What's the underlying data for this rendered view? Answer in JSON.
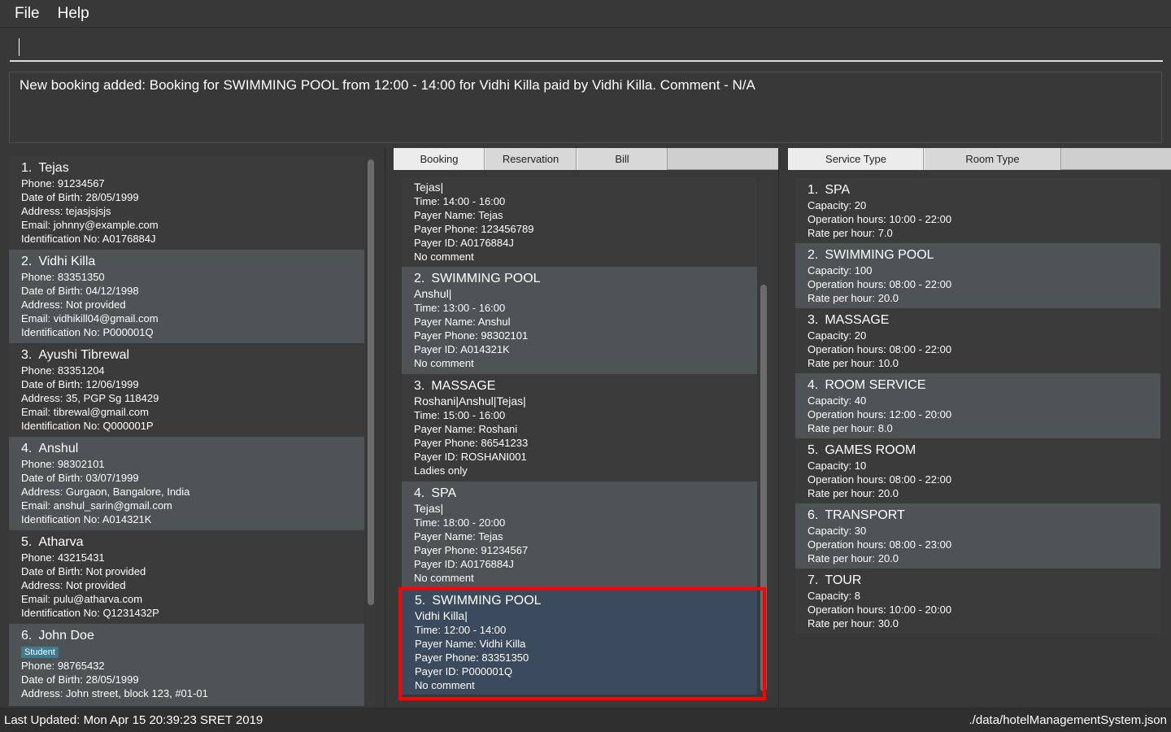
{
  "menu": [
    "File",
    "Help"
  ],
  "command": {
    "value": "",
    "placeholder": ""
  },
  "result": "New booking added: Booking for SWIMMING POOL from 12:00 - 14:00 for Vidhi Killa paid by Vidhi Killa. Comment - N/A",
  "customers": [
    {
      "num": "1.",
      "name": "Tejas",
      "tag": "",
      "lines": [
        "Phone: 91234567",
        "Date of Birth: 28/05/1999",
        "Address: tejasjsjsjs",
        "Email: johnny@example.com",
        "Identification No: A0176884J"
      ]
    },
    {
      "num": "2.",
      "name": "Vidhi Killa",
      "tag": "",
      "lines": [
        "Phone: 83351350",
        "Date of Birth: 04/12/1998",
        "Address: Not provided",
        "Email: vidhikill04@gmail.com",
        "Identification No: P000001Q"
      ]
    },
    {
      "num": "3.",
      "name": "Ayushi Tibrewal",
      "tag": "",
      "lines": [
        "Phone: 83351204",
        "Date of Birth: 12/06/1999",
        "Address: 35, PGP Sg 118429",
        "Email: tibrewal@gmail.com",
        "Identification No: Q000001P"
      ]
    },
    {
      "num": "4.",
      "name": "Anshul",
      "tag": "",
      "lines": [
        "Phone: 98302101",
        "Date of Birth: 03/07/1999",
        "Address: Gurgaon, Bangalore, India",
        "Email: anshul_sarin@gmail.com",
        "Identification No: A014321K"
      ]
    },
    {
      "num": "5.",
      "name": "Atharva",
      "tag": "",
      "lines": [
        "Phone: 43215431",
        "Date of Birth: Not provided",
        "Address: Not provided",
        "Email: pulu@atharva.com",
        "Identification No: Q1231432P"
      ]
    },
    {
      "num": "6.",
      "name": "John Doe",
      "tag": "Student",
      "lines": [
        "Phone: 98765432",
        "Date of Birth: 28/05/1999",
        "Address: John street, block 123, #01-01"
      ]
    }
  ],
  "middle_tabs": [
    "Booking",
    "Reservation",
    "Bill"
  ],
  "bookings": [
    {
      "num": "",
      "service": "",
      "names": "Tejas|",
      "lines": [
        "Time: 14:00 - 16:00",
        "Payer Name: Tejas",
        "Payer Phone: 123456789",
        "Payer ID: A0176884J",
        "No comment"
      ]
    },
    {
      "num": "2.",
      "service": "SWIMMING POOL",
      "names": "Anshul|",
      "lines": [
        "Time: 13:00 - 16:00",
        "Payer Name: Anshul",
        "Payer Phone: 98302101",
        "Payer ID: A014321K",
        "No comment"
      ]
    },
    {
      "num": "3.",
      "service": "MASSAGE",
      "names": "Roshani|Anshul|Tejas|",
      "lines": [
        "Time: 15:00 - 16:00",
        "Payer Name: Roshani",
        "Payer Phone: 86541233",
        "Payer ID: ROSHANI001",
        "Ladies only"
      ]
    },
    {
      "num": "4.",
      "service": "SPA",
      "names": "Tejas|",
      "lines": [
        "Time: 18:00 - 20:00",
        "Payer Name: Tejas",
        "Payer Phone: 91234567",
        "Payer ID: A0176884J",
        "No comment"
      ]
    },
    {
      "num": "5.",
      "service": "SWIMMING POOL",
      "names": "Vidhi Killa|",
      "lines": [
        "Time: 12:00 - 14:00",
        "Payer Name: Vidhi Killa",
        "Payer Phone: 83351350",
        "Payer ID: P000001Q",
        "No comment"
      ]
    }
  ],
  "right_tabs": [
    "Service Type",
    "Room Type"
  ],
  "services": [
    {
      "num": "1.",
      "name": "SPA",
      "lines": [
        "Capacity: 20",
        "Operation hours: 10:00 - 22:00",
        "Rate per hour: 7.0"
      ]
    },
    {
      "num": "2.",
      "name": "SWIMMING POOL",
      "lines": [
        "Capacity: 100",
        "Operation hours: 08:00 - 22:00",
        "Rate per hour: 20.0"
      ]
    },
    {
      "num": "3.",
      "name": "MASSAGE",
      "lines": [
        "Capacity: 20",
        "Operation hours: 08:00 - 22:00",
        "Rate per hour: 10.0"
      ]
    },
    {
      "num": "4.",
      "name": "ROOM SERVICE",
      "lines": [
        "Capacity: 40",
        "Operation hours: 12:00 - 20:00",
        "Rate per hour: 8.0"
      ]
    },
    {
      "num": "5.",
      "name": "GAMES ROOM",
      "lines": [
        "Capacity: 10",
        "Operation hours: 08:00 - 22:00",
        "Rate per hour: 20.0"
      ]
    },
    {
      "num": "6.",
      "name": "TRANSPORT",
      "lines": [
        "Capacity: 30",
        "Operation hours: 08:00 - 23:00",
        "Rate per hour: 20.0"
      ]
    },
    {
      "num": "7.",
      "name": "TOUR",
      "lines": [
        "Capacity: 8",
        "Operation hours: 10:00 - 20:00",
        "Rate per hour: 30.0"
      ]
    }
  ],
  "status": {
    "left": "Last Updated: Mon Apr 15 20:39:23 SRET 2019",
    "right": "./data/hotelManagementSystem.json"
  }
}
